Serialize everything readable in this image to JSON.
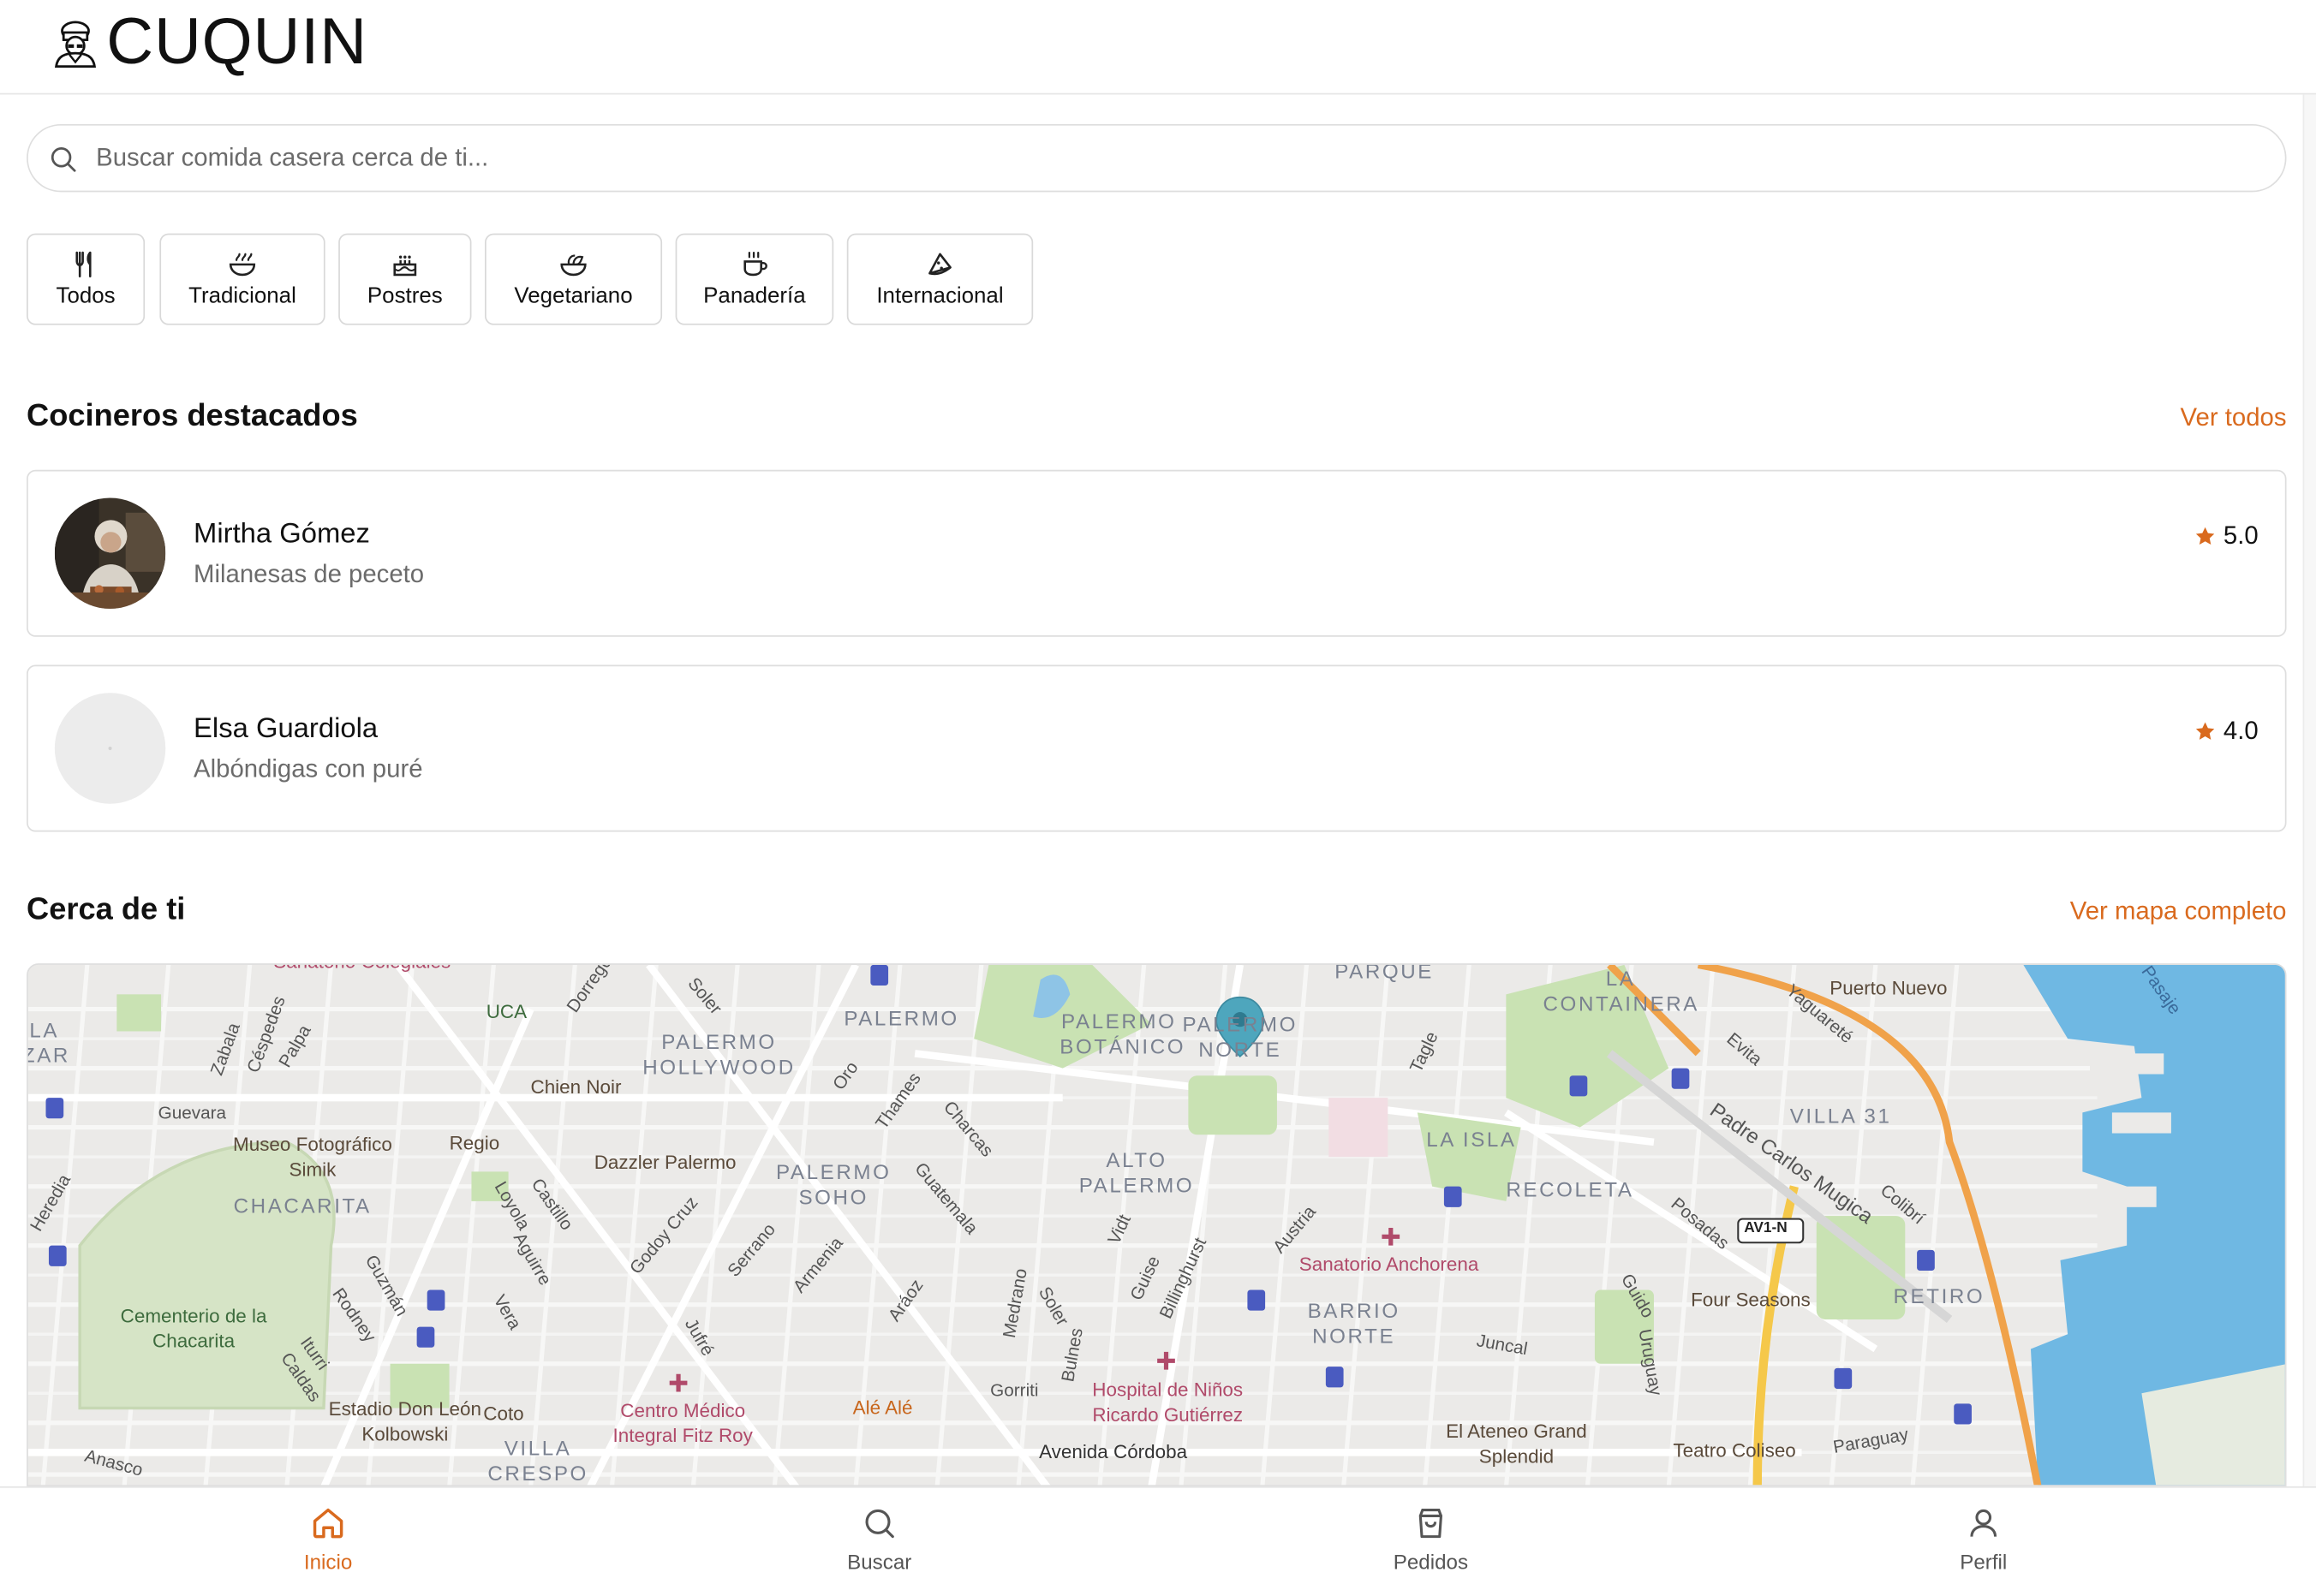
{
  "app": {
    "name": "CUQUIN"
  },
  "search": {
    "placeholder": "Buscar comida casera cerca de ti..."
  },
  "categories": [
    {
      "label": "Todos",
      "icon": "utensils-icon"
    },
    {
      "label": "Tradicional",
      "icon": "bowl-icon"
    },
    {
      "label": "Postres",
      "icon": "cake-icon"
    },
    {
      "label": "Vegetariano",
      "icon": "salad-icon"
    },
    {
      "label": "Panadería",
      "icon": "coffee-icon"
    },
    {
      "label": "Internacional",
      "icon": "pizza-icon"
    }
  ],
  "featured": {
    "title": "Cocineros destacados",
    "link": "Ver todos",
    "cooks": [
      {
        "name": "Mirtha Gómez",
        "dish": "Milanesas de peceto",
        "rating": "5.0"
      },
      {
        "name": "Elsa Guardiola",
        "dish": "Albóndigas con puré",
        "rating": "4.0"
      }
    ]
  },
  "nearby": {
    "title": "Cerca de ti",
    "link": "Ver mapa completo",
    "map_labels": {
      "areas": [
        "PALERMO",
        "PALERMO HOLLYWOOD",
        "PALERMO BOTÁNICO",
        "PALERMO NORTE",
        "PARQUE",
        "LA CONTAINERA",
        "PALERMO SOHO",
        "ALTO PALERMO",
        "LA ISLA",
        "RECOLETA",
        "VILLA 31",
        "CHACARITA",
        "BARRIO NORTE",
        "RETIRO",
        "VILLA CRESPO",
        "LA ZAR"
      ],
      "places": [
        "UCA",
        "Chien Noir",
        "Museo Fotográfico Simik",
        "Regio",
        "Dazzler Palermo",
        "Cementerio de la Chacarita",
        "Estadio Don León Kolbowski",
        "Coto",
        "Centro Médico Integral Fitz Roy",
        "Alé Alé",
        "Hospital de Niños Ricardo Gutiérrez",
        "Sanatorio Anchorena",
        "Four Seasons",
        "El Ateneo Grand Splendid",
        "Teatro Coliseo",
        "Puerto Nuevo",
        "Sanatorio Colegiales"
      ],
      "streets": [
        "Guevara",
        "Zabala",
        "Céspedes",
        "Palpa",
        "Dorrego",
        "Soler",
        "Oro",
        "Thames",
        "Charcas",
        "Guatemala",
        "Serrano",
        "Armenia",
        "Godoy Cruz",
        "Loyola",
        "Castillo",
        "Aguirre",
        "Vera",
        "Guzmán",
        "Rodney",
        "Iturri",
        "Caldas",
        "Jufré",
        "Aráoz",
        "Medrano",
        "Soler",
        "Bulnes",
        "Gorriti",
        "Vidt",
        "Guise",
        "Billinghurst",
        "Austria",
        "Tagle",
        "Juncal",
        "Guido",
        "Uruguay",
        "Paraguay",
        "Posadas",
        "Padre Carlos Mugica",
        "Yaguareté",
        "Evita",
        "Colibrí",
        "Pasaje",
        "Avenida Córdoba",
        "Heredia",
        "Anasco",
        "AV1-N"
      ]
    }
  },
  "nav": [
    {
      "label": "Inicio",
      "icon": "home-icon",
      "active": true
    },
    {
      "label": "Buscar",
      "icon": "search-icon",
      "active": false
    },
    {
      "label": "Pedidos",
      "icon": "shopping-bag-icon",
      "active": false
    },
    {
      "label": "Perfil",
      "icon": "user-icon",
      "active": false
    }
  ],
  "colors": {
    "accent": "#d96a1e",
    "star": "#d96a1e",
    "water": "#6fb8e3",
    "park": "#c9e2b3",
    "highway": "#f0a24a",
    "pin": "#4ea6bd"
  }
}
